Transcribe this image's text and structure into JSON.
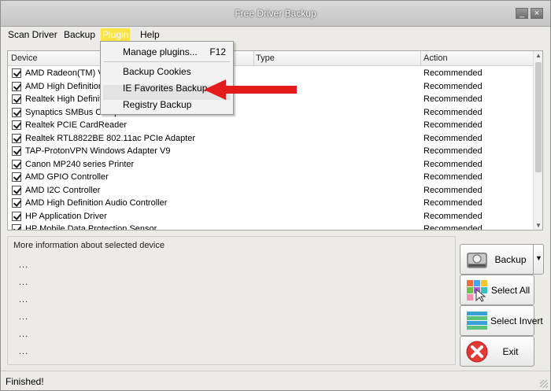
{
  "window": {
    "title": "Free Driver Backup",
    "minimize_glyph": "_",
    "close_glyph": "×"
  },
  "menubar": {
    "items": [
      "Scan Driver",
      "Backup",
      "Plugin",
      "Help"
    ]
  },
  "plugin_menu": {
    "items": [
      {
        "label": "Manage plugins...",
        "shortcut": "F12"
      },
      {
        "label": "Backup Cookies",
        "shortcut": ""
      },
      {
        "label": "IE Favorites Backup",
        "shortcut": ""
      },
      {
        "label": "Registry Backup",
        "shortcut": ""
      }
    ],
    "annotation_arrow_color": "#e41b1b"
  },
  "device_list": {
    "columns": [
      "Device",
      "Type",
      "Action"
    ],
    "rows": [
      {
        "device": "AMD Radeon(TM) Ve",
        "action": "Recommended",
        "checked": true
      },
      {
        "device": "AMD High Definition",
        "action": "Recommended",
        "checked": true
      },
      {
        "device": "Realtek High Definiti",
        "action": "Recommended",
        "checked": true
      },
      {
        "device": "Synaptics SMBus Clickpad",
        "action": "Recommended",
        "checked": true
      },
      {
        "device": "Realtek PCIE CardReader",
        "action": "Recommended",
        "checked": true
      },
      {
        "device": "Realtek RTL8822BE 802.11ac PCIe Adapter",
        "action": "Recommended",
        "checked": true
      },
      {
        "device": "TAP-ProtonVPN Windows Adapter V9",
        "action": "Recommended",
        "checked": true
      },
      {
        "device": "Canon MP240 series Printer",
        "action": "Recommended",
        "checked": true
      },
      {
        "device": "AMD GPIO Controller",
        "action": "Recommended",
        "checked": true
      },
      {
        "device": "AMD I2C Controller",
        "action": "Recommended",
        "checked": true
      },
      {
        "device": "AMD High Definition Audio Controller",
        "action": "Recommended",
        "checked": true
      },
      {
        "device": "HP Application Driver",
        "action": "Recommended",
        "checked": true
      },
      {
        "device": "HP Mobile Data Protection Sensor",
        "action": "Recommended",
        "checked": true
      }
    ]
  },
  "info_panel": {
    "label": "More information about selected device",
    "lines": [
      "...",
      "...",
      "...",
      "...",
      "...",
      "..."
    ]
  },
  "buttons": {
    "backup": "Backup",
    "select_all": "Select All",
    "select_invert": "Select Invert",
    "exit": "Exit",
    "split_glyph": "▼"
  },
  "status": {
    "text": "Finished!"
  },
  "colors": {
    "menu_highlight": "#f9e443",
    "exit_red": "#e53935",
    "arrow_red": "#e41b1b"
  }
}
